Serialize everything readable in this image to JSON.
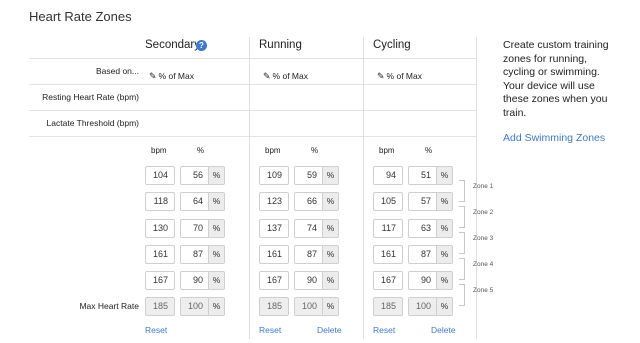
{
  "page_title": "Heart Rate Zones",
  "columns": [
    {
      "key": "secondary",
      "title": "Secondary",
      "based_on": "% of Max",
      "has_help": true,
      "bpm": [
        "104",
        "118",
        "130",
        "161",
        "167"
      ],
      "pct": [
        "56",
        "64",
        "70",
        "87",
        "90"
      ],
      "max_bpm": "185",
      "max_pct": "100",
      "reset": "Reset",
      "delete": ""
    },
    {
      "key": "running",
      "title": "Running",
      "based_on": "% of Max",
      "has_help": false,
      "bpm": [
        "109",
        "123",
        "137",
        "161",
        "167"
      ],
      "pct": [
        "59",
        "66",
        "74",
        "87",
        "90"
      ],
      "max_bpm": "185",
      "max_pct": "100",
      "reset": "Reset",
      "delete": "Delete"
    },
    {
      "key": "cycling",
      "title": "Cycling",
      "based_on": "% of Max",
      "has_help": false,
      "bpm": [
        "94",
        "105",
        "117",
        "161",
        "167"
      ],
      "pct": [
        "51",
        "57",
        "63",
        "87",
        "90"
      ],
      "max_bpm": "185",
      "max_pct": "100",
      "reset": "Reset",
      "delete": "Delete"
    }
  ],
  "help_icon_glyph": "?",
  "row_labels": {
    "based_on": "Based on...",
    "resting": "Resting Heart Rate (bpm)",
    "lactate": "Lactate Threshold (bpm)",
    "max": "Max Heart Rate"
  },
  "subheaders": {
    "bpm": "bpm",
    "pct": "%"
  },
  "pct_unit": "%",
  "zones": [
    "Zone 1",
    "Zone 2",
    "Zone 3",
    "Zone 4",
    "Zone 5"
  ],
  "sidebar": {
    "description": "Create custom training zones for running, cycling or swimming. Your device will use these zones when you train.",
    "add_link": "Add Swimming Zones"
  },
  "colors": {
    "accent": "#3f78cf",
    "border": "#cfcfcf",
    "disabled": "#eeeeee"
  },
  "icons": {
    "pencil": "pencil-icon",
    "help": "help-icon"
  }
}
